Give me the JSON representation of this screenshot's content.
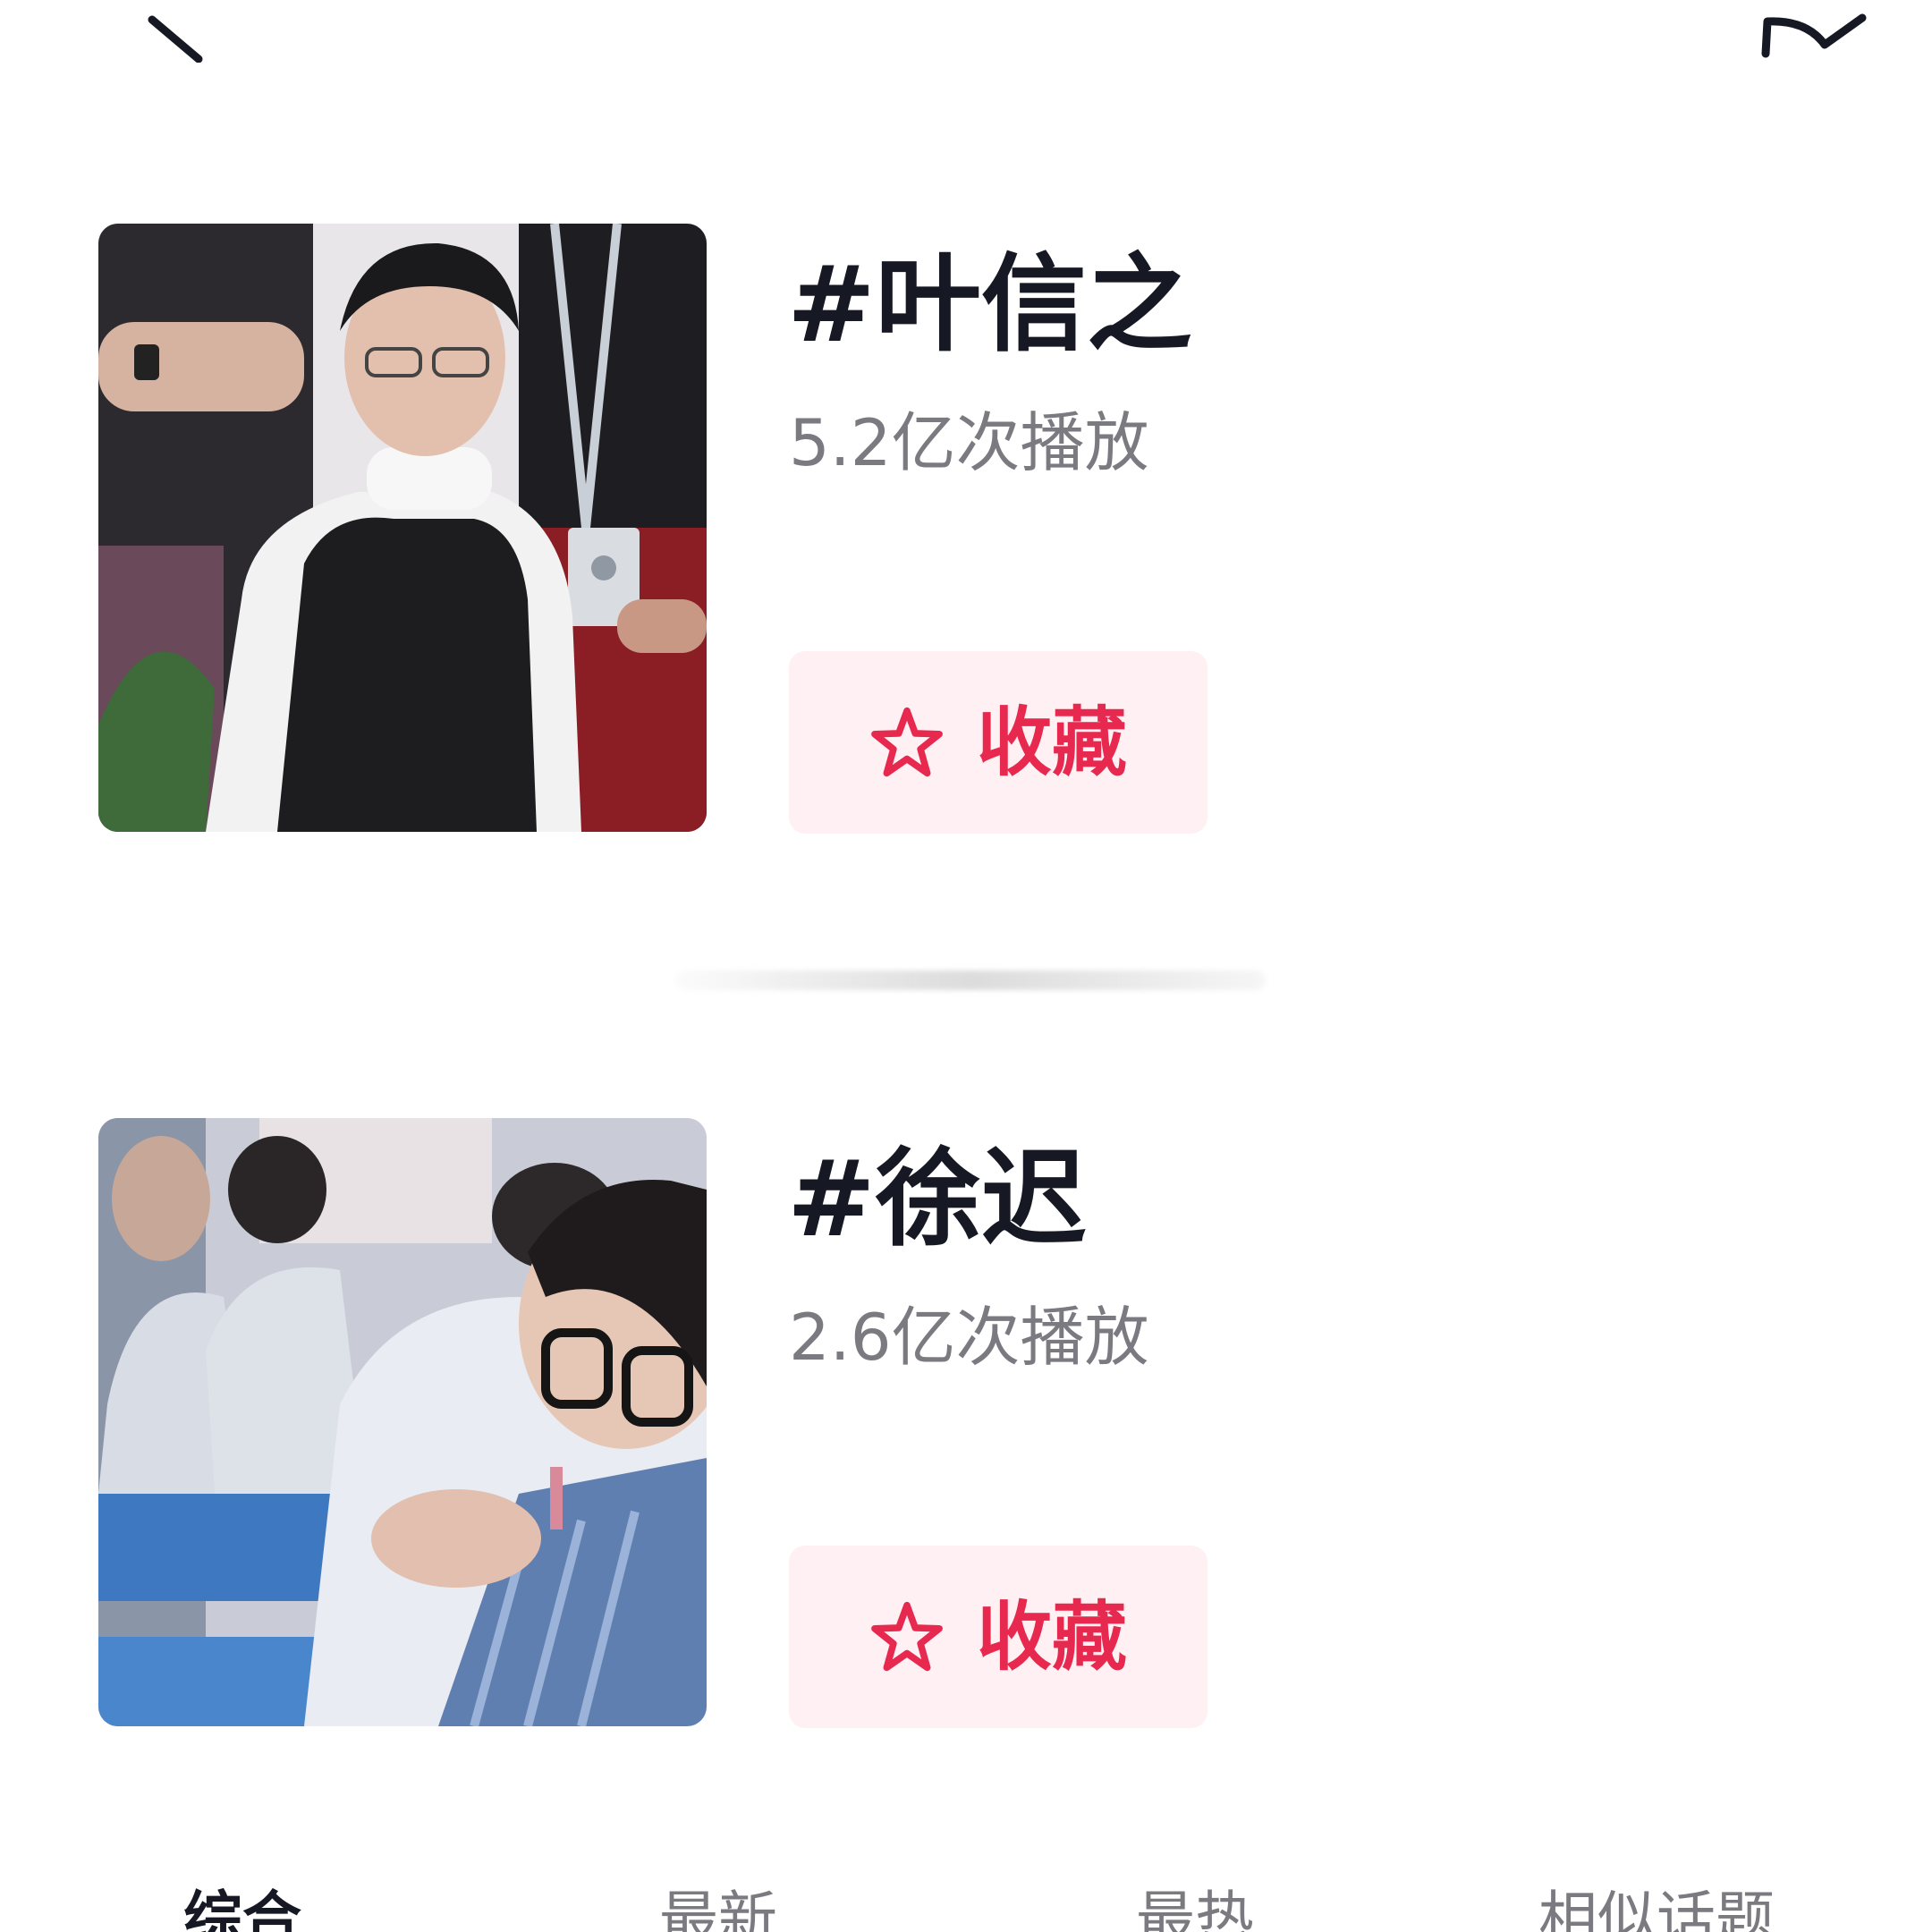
{
  "header": {
    "back_icon": "back-arrow-icon",
    "share_icon": "share-icon"
  },
  "topics": [
    {
      "title": "#叶信之",
      "views": "5.2亿次播放",
      "favorite_label": "收藏",
      "thumbnail": "man-in-vest-photo"
    },
    {
      "title": "#徐迟",
      "views": "2.6亿次播放",
      "favorite_label": "收藏",
      "thumbnail": "classroom-photo"
    }
  ],
  "tabs": [
    {
      "label": "综合",
      "active": true
    },
    {
      "label": "最新",
      "active": false
    },
    {
      "label": "最热",
      "active": false
    },
    {
      "label": "相似话题",
      "active": false
    }
  ],
  "colors": {
    "accent": "#e8294f",
    "button_bg": "#fff1f3",
    "title_text": "#161823",
    "secondary_text": "#7a7a80"
  }
}
